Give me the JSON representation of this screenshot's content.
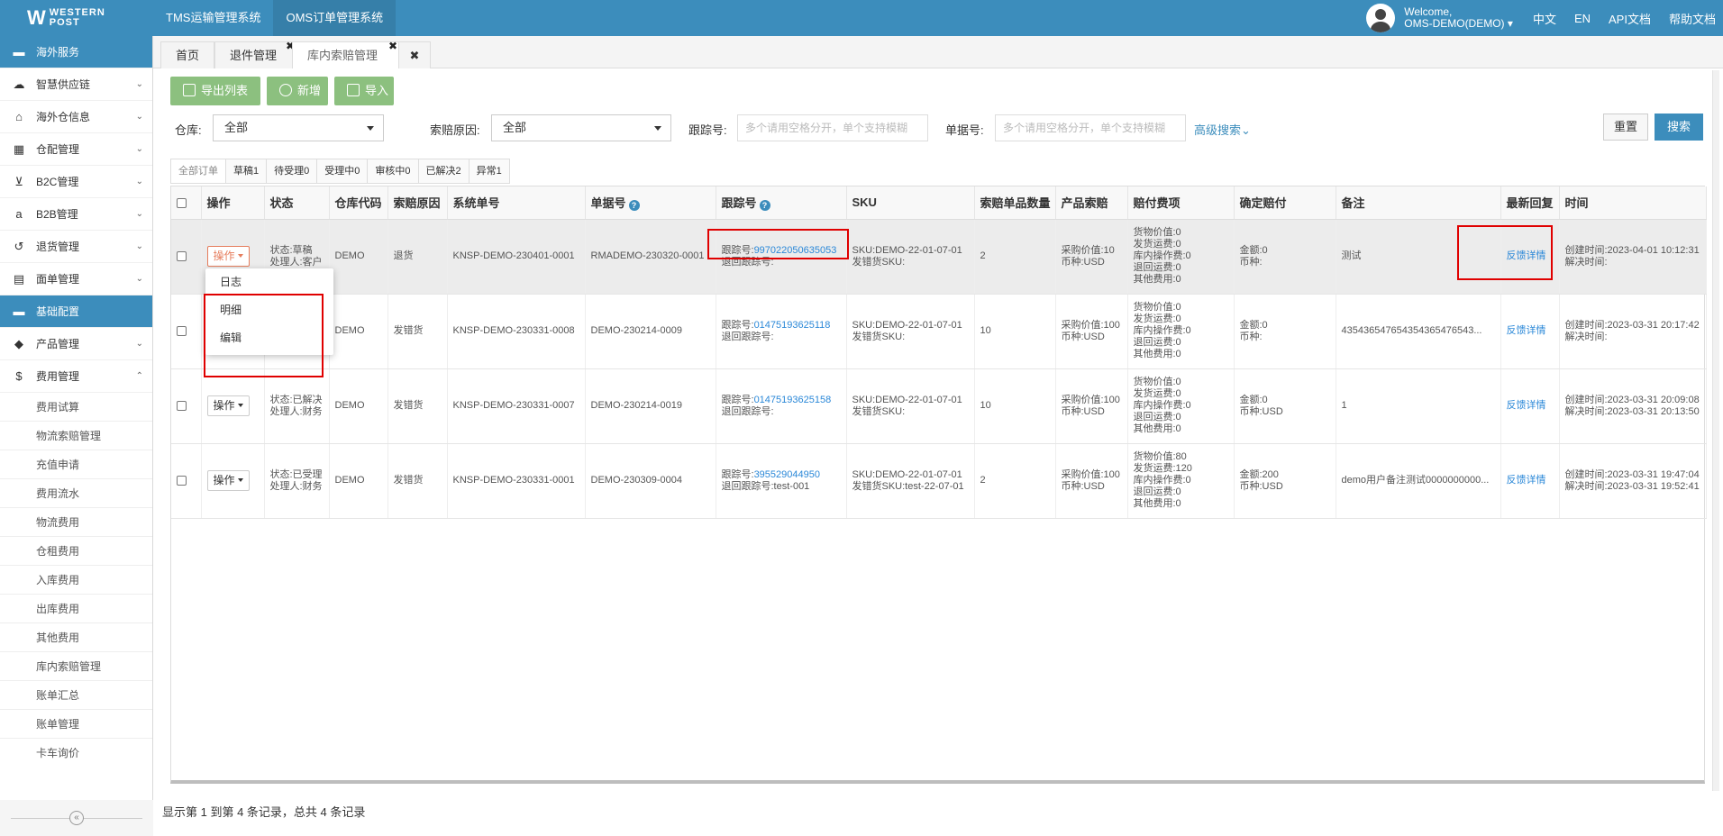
{
  "header": {
    "logo_line1": "WESTERN",
    "logo_line2": "POST",
    "systems": [
      "TMS运输管理系统",
      "OMS订单管理系统"
    ],
    "welcome": "Welcome,",
    "user": "OMS-DEMO(DEMO)",
    "links": [
      "中文",
      "EN",
      "API文档",
      "帮助文档"
    ]
  },
  "sidebar": {
    "items": [
      {
        "label": "海外服务",
        "icon": "folder-icon",
        "highlight": true
      },
      {
        "label": "智慧供应链",
        "icon": "cloud-icon"
      },
      {
        "label": "海外仓信息",
        "icon": "home-icon"
      },
      {
        "label": "仓配管理",
        "icon": "grid-icon"
      },
      {
        "label": "B2C管理",
        "icon": "cart-icon"
      },
      {
        "label": "B2B管理",
        "icon": "amazon-icon"
      },
      {
        "label": "退货管理",
        "icon": "undo-icon"
      },
      {
        "label": "面单管理",
        "icon": "file-icon"
      },
      {
        "label": "基础配置",
        "icon": "folder-icon",
        "highlight": true
      },
      {
        "label": "产品管理",
        "icon": "tag-icon"
      },
      {
        "label": "费用管理",
        "icon": "dollar-icon",
        "expanded": true
      }
    ],
    "sub_items": [
      "费用试算",
      "物流索赔管理",
      "充值申请",
      "费用流水",
      "物流费用",
      "仓租费用",
      "入库费用",
      "出库费用",
      "其他费用",
      "库内索赔管理",
      "账单汇总",
      "账单管理",
      "卡车询价"
    ]
  },
  "page_tabs": [
    {
      "label": "首页"
    },
    {
      "label": "退件管理",
      "closable": true
    },
    {
      "label": "库内索赔管理",
      "closable": true,
      "active": true
    }
  ],
  "toolbar": {
    "export": "导出列表",
    "add": "新增",
    "import": "导入"
  },
  "filters": {
    "warehouse_label": "仓库:",
    "warehouse_value": "全部",
    "reason_label": "索赔原因:",
    "reason_value": "全部",
    "tracking_label": "跟踪号:",
    "tracking_placeholder": "多个请用空格分开，单个支持模糊",
    "order_label": "单据号:",
    "order_placeholder": "多个请用空格分开，单个支持模糊",
    "advanced": "高级搜索",
    "reset": "重置",
    "search": "搜索"
  },
  "status_tabs": [
    "全部订单",
    "草稿1",
    "待受理0",
    "受理中0",
    "审核中0",
    "已解决2",
    "异常1"
  ],
  "table": {
    "columns": [
      "操作",
      "状态",
      "仓库代码",
      "索赔原因",
      "系统单号",
      "单据号",
      "跟踪号",
      "SKU",
      "索赔单品数量",
      "产品索赔",
      "赔付费项",
      "确定赔付",
      "备注",
      "最新回复",
      "时间"
    ],
    "op_label": "操作",
    "rows": [
      {
        "status": "状态:草稿",
        "handler": "处理人:客户",
        "warehouse": "DEMO",
        "reason": "退货",
        "system_no": "KNSP-DEMO-230401-0001",
        "order_no": "RMADEMO-230320-0001",
        "tracking_prefix": "跟踪号:",
        "tracking": "997022050635053",
        "return_tracking": "退回跟踪号:",
        "sku": "SKU:DEMO-22-01-07-01",
        "wrong_sku": "发错货SKU:",
        "qty": "2",
        "purchase": "采购价值:10",
        "currency": "币种:USD",
        "fees": [
          "货物价值:0",
          "发货运费:0",
          "库内操作费:0",
          "退回运费:0",
          "其他费用:0"
        ],
        "amount": "金额:0",
        "amount_currency": "币种:",
        "remark": "测试",
        "reply": "反馈详情",
        "created": "创建时间:2023-04-01 10:12:31",
        "resolved": "解决时间:"
      },
      {
        "status": "",
        "handler": "",
        "warehouse": "DEMO",
        "reason": "发错货",
        "system_no": "KNSP-DEMO-230331-0008",
        "order_no": "DEMO-230214-0009",
        "tracking_prefix": "跟踪号:",
        "tracking": "01475193625118",
        "return_tracking": "退回跟踪号:",
        "sku": "SKU:DEMO-22-01-07-01",
        "wrong_sku": "发错货SKU:",
        "qty": "10",
        "purchase": "采购价值:100",
        "currency": "币种:USD",
        "fees": [
          "货物价值:0",
          "发货运费:0",
          "库内操作费:0",
          "退回运费:0",
          "其他费用:0"
        ],
        "amount": "金额:0",
        "amount_currency": "币种:",
        "remark": "435436547654354365476543...",
        "reply": "反馈详情",
        "created": "创建时间:2023-03-31 20:17:42",
        "resolved": "解决时间:"
      },
      {
        "status": "状态:已解决",
        "handler": "处理人:财务",
        "warehouse": "DEMO",
        "reason": "发错货",
        "system_no": "KNSP-DEMO-230331-0007",
        "order_no": "DEMO-230214-0019",
        "tracking_prefix": "跟踪号:",
        "tracking": "01475193625158",
        "return_tracking": "退回跟踪号:",
        "sku": "SKU:DEMO-22-01-07-01",
        "wrong_sku": "发错货SKU:",
        "qty": "10",
        "purchase": "采购价值:100",
        "currency": "币种:USD",
        "fees": [
          "货物价值:0",
          "发货运费:0",
          "库内操作费:0",
          "退回运费:0",
          "其他费用:0"
        ],
        "amount": "金额:0",
        "amount_currency": "币种:USD",
        "remark": "1",
        "reply": "反馈详情",
        "created": "创建时间:2023-03-31 20:09:08",
        "resolved": "解决时间:2023-03-31 20:13:50"
      },
      {
        "status": "状态:已受理",
        "handler": "处理人:财务",
        "warehouse": "DEMO",
        "reason": "发错货",
        "system_no": "KNSP-DEMO-230331-0001",
        "order_no": "DEMO-230309-0004",
        "tracking_prefix": "跟踪号:",
        "tracking": "395529044950",
        "return_tracking": "退回跟踪号:test-001",
        "sku": "SKU:DEMO-22-01-07-01",
        "wrong_sku": "发错货SKU:test-22-07-01",
        "qty": "2",
        "purchase": "采购价值:100",
        "currency": "币种:USD",
        "fees": [
          "货物价值:80",
          "发货运费:120",
          "库内操作费:0",
          "退回运费:0",
          "其他费用:0"
        ],
        "amount": "金额:200",
        "amount_currency": "币种:USD",
        "remark": "demo用户备注测试0000000000...",
        "reply": "反馈详情",
        "created": "创建时间:2023-03-31 19:47:04",
        "resolved": "解决时间:2023-03-31 19:52:41"
      }
    ]
  },
  "dropdown": [
    "日志",
    "明细",
    "编辑"
  ],
  "footer": "显示第 1 到第 4 条记录，总共 4 条记录"
}
